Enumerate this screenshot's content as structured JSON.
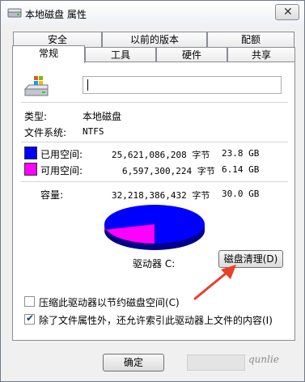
{
  "window": {
    "title": "本地磁盘 属性",
    "close_symbol": "✕"
  },
  "tabs": {
    "row1": [
      {
        "label": "安全"
      },
      {
        "label": "以前的版本"
      },
      {
        "label": "配额"
      }
    ],
    "row2": [
      {
        "label": "常规",
        "active": true
      },
      {
        "label": "工具"
      },
      {
        "label": "硬件"
      },
      {
        "label": "共享"
      }
    ]
  },
  "general": {
    "drive_icon": "drive-icon",
    "name_value": "",
    "type_label": "类型:",
    "type_value": "本地磁盘",
    "fs_label": "文件系统:",
    "fs_value": "NTFS",
    "used_label": "已用空间:",
    "used_bytes": "25,621,086,208 字节",
    "used_size": "23.8 GB",
    "free_label": "可用空间:",
    "free_bytes": "6,597,300,224 字节",
    "free_size": "6.14 GB",
    "capacity_label": "容量:",
    "capacity_bytes": "32,218,386,432 字节",
    "capacity_size": "30.0 GB",
    "drive_label": "驱动器 C:",
    "cleanup_button": "磁盘清理(D)",
    "used_color": "#0000ff",
    "free_color": "#ff00ff",
    "used_fraction": 0.795
  },
  "options": {
    "compress_label": "压缩此驱动器以节约磁盘空间(C)",
    "compress_checked": false,
    "index_label": "除了文件属性外，还允许索引此驱动器上文件的内容(I)",
    "index_checked": true
  },
  "footer": {
    "ok_button": "确定",
    "watermark": "qunlie"
  },
  "annotation": {
    "arrow_color": "#e8402a"
  }
}
